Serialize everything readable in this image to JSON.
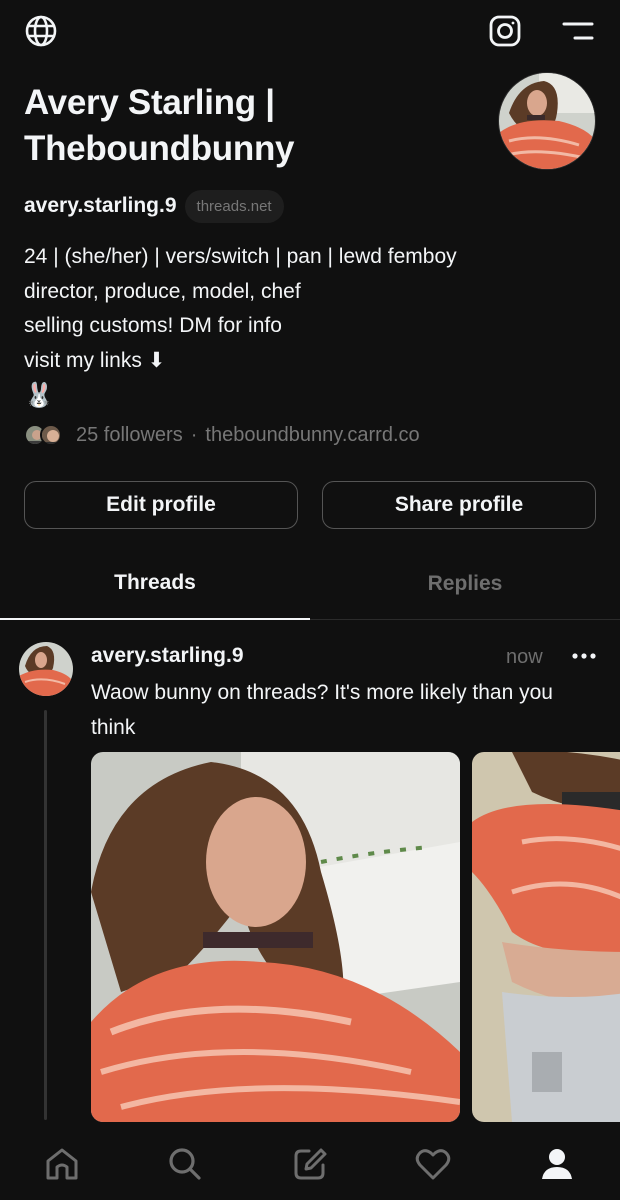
{
  "profile": {
    "display_name": "Avery Starling | Theboundbunny",
    "handle": "avery.starling.9",
    "domain_badge": "threads.net",
    "bio_lines": [
      "24 | (she/her) | vers/switch | pan | lewd femboy",
      "director, produce, model, chef",
      "selling customs! DM for info",
      "visit my links ⬇",
      "🐰"
    ],
    "followers_text": "25 followers",
    "separator": "·",
    "link": "theboundbunny.carrd.co"
  },
  "actions": {
    "edit_label": "Edit profile",
    "share_label": "Share profile"
  },
  "tabs": [
    {
      "label": "Threads",
      "active": true
    },
    {
      "label": "Replies",
      "active": false
    }
  ],
  "post": {
    "username": "avery.starling.9",
    "time": "now",
    "text": "Waow bunny on threads? It's more likely than you think",
    "media_count": 2
  },
  "icons": {
    "top_left": "globe-icon",
    "top_right": [
      "instagram-icon",
      "menu-icon"
    ],
    "post_more": "more-dots-icon",
    "bottom_nav": [
      "home-icon",
      "search-icon",
      "compose-icon",
      "heart-icon",
      "profile-icon"
    ]
  },
  "colors": {
    "background": "#101010",
    "text": "#f3f5f7",
    "secondary": "#777777",
    "accent_shirt": "#e8684a"
  }
}
